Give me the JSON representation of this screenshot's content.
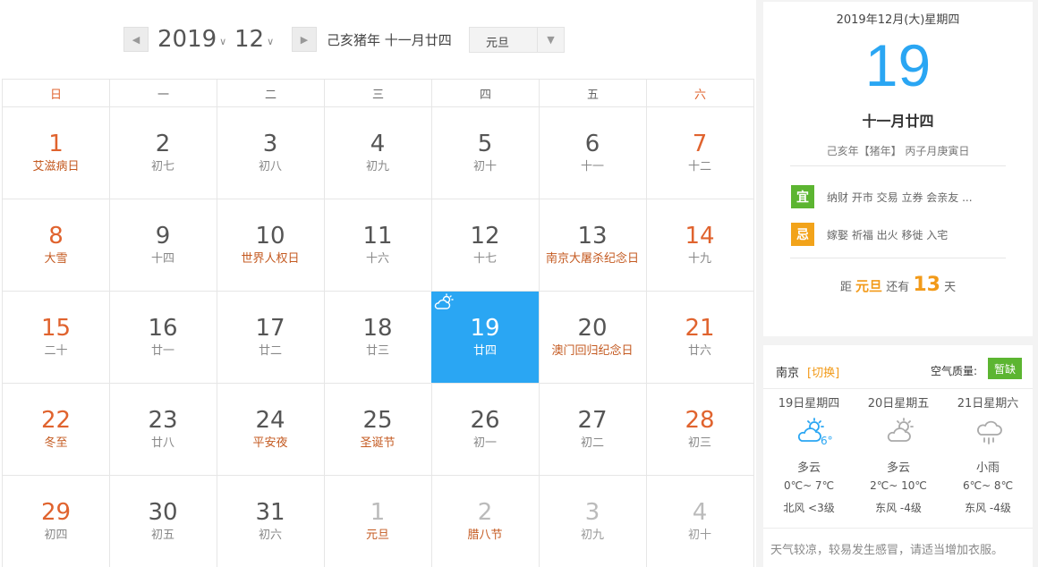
{
  "header": {
    "prev_symbol": "◀",
    "next_symbol": "▶",
    "year": "2019",
    "month": "12",
    "caret": "∨",
    "lunar_year": "己亥猪年 十一月廿四",
    "holiday_value": "元旦",
    "holiday_arrow": "▼"
  },
  "weekdays": [
    "日",
    "一",
    "二",
    "三",
    "四",
    "五",
    "六"
  ],
  "days": [
    {
      "d": "1",
      "sub": "艾滋病日",
      "fest": true,
      "other": false,
      "weekend": true
    },
    {
      "d": "2",
      "sub": "初七",
      "fest": false,
      "other": false,
      "weekend": false
    },
    {
      "d": "3",
      "sub": "初八",
      "fest": false,
      "other": false,
      "weekend": false
    },
    {
      "d": "4",
      "sub": "初九",
      "fest": false,
      "other": false,
      "weekend": false
    },
    {
      "d": "5",
      "sub": "初十",
      "fest": false,
      "other": false,
      "weekend": false
    },
    {
      "d": "6",
      "sub": "十一",
      "fest": false,
      "other": false,
      "weekend": false
    },
    {
      "d": "7",
      "sub": "十二",
      "fest": false,
      "other": false,
      "weekend": true
    },
    {
      "d": "8",
      "sub": "大雪",
      "fest": true,
      "other": false,
      "weekend": true
    },
    {
      "d": "9",
      "sub": "十四",
      "fest": false,
      "other": false,
      "weekend": false
    },
    {
      "d": "10",
      "sub": "世界人权日",
      "fest": true,
      "other": false,
      "weekend": false
    },
    {
      "d": "11",
      "sub": "十六",
      "fest": false,
      "other": false,
      "weekend": false
    },
    {
      "d": "12",
      "sub": "十七",
      "fest": false,
      "other": false,
      "weekend": false
    },
    {
      "d": "13",
      "sub": "南京大屠杀纪念日",
      "fest": true,
      "other": false,
      "weekend": false
    },
    {
      "d": "14",
      "sub": "十九",
      "fest": false,
      "other": false,
      "weekend": true
    },
    {
      "d": "15",
      "sub": "二十",
      "fest": false,
      "other": false,
      "weekend": true
    },
    {
      "d": "16",
      "sub": "廿一",
      "fest": false,
      "other": false,
      "weekend": false
    },
    {
      "d": "17",
      "sub": "廿二",
      "fest": false,
      "other": false,
      "weekend": false
    },
    {
      "d": "18",
      "sub": "廿三",
      "fest": false,
      "other": false,
      "weekend": false
    },
    {
      "d": "19",
      "sub": "廿四",
      "fest": false,
      "other": false,
      "weekend": false,
      "today": true
    },
    {
      "d": "20",
      "sub": "澳门回归纪念日",
      "fest": true,
      "other": false,
      "weekend": false
    },
    {
      "d": "21",
      "sub": "廿六",
      "fest": false,
      "other": false,
      "weekend": true
    },
    {
      "d": "22",
      "sub": "冬至",
      "fest": true,
      "other": false,
      "weekend": true
    },
    {
      "d": "23",
      "sub": "廿八",
      "fest": false,
      "other": false,
      "weekend": false
    },
    {
      "d": "24",
      "sub": "平安夜",
      "fest": true,
      "other": false,
      "weekend": false
    },
    {
      "d": "25",
      "sub": "圣诞节",
      "fest": true,
      "other": false,
      "weekend": false
    },
    {
      "d": "26",
      "sub": "初一",
      "fest": false,
      "other": false,
      "weekend": false
    },
    {
      "d": "27",
      "sub": "初二",
      "fest": false,
      "other": false,
      "weekend": false
    },
    {
      "d": "28",
      "sub": "初三",
      "fest": false,
      "other": false,
      "weekend": true
    },
    {
      "d": "29",
      "sub": "初四",
      "fest": false,
      "other": false,
      "weekend": true
    },
    {
      "d": "30",
      "sub": "初五",
      "fest": false,
      "other": false,
      "weekend": false
    },
    {
      "d": "31",
      "sub": "初六",
      "fest": false,
      "other": false,
      "weekend": false
    },
    {
      "d": "1",
      "sub": "元旦",
      "fest": true,
      "other": true,
      "weekend": false
    },
    {
      "d": "2",
      "sub": "腊八节",
      "fest": true,
      "other": true,
      "weekend": false
    },
    {
      "d": "3",
      "sub": "初九",
      "fest": false,
      "other": true,
      "weekend": false
    },
    {
      "d": "4",
      "sub": "初十",
      "fest": false,
      "other": true,
      "weekend": false
    }
  ],
  "detail": {
    "date": "2019年12月(大)星期四",
    "day": "19",
    "lunar": "十一月廿四",
    "ganzhi": "己亥年【猪年】 丙子月庚寅日",
    "yi_label": "宜",
    "yi_text": "纳财 开市 交易 立券 会亲友 ...",
    "ji_label": "忌",
    "ji_text": "嫁娶 祈福 出火 移徙 入宅",
    "countdown_pre": "距",
    "countdown_holiday": "元旦",
    "countdown_mid": "还有",
    "countdown_days": "13",
    "countdown_post": "天",
    "yi_color": "#5cb531",
    "ji_color": "#f2a31a"
  },
  "weather": {
    "city": "南京",
    "switch_label": "[切换]",
    "aq_label": "空气质量:",
    "aq_value": "暂缺",
    "forecast": [
      {
        "day": "19日星期四",
        "icon": "partly-cloudy-icon",
        "current": "6°",
        "desc": "多云",
        "temp": "0℃~ 7℃",
        "wind": "北风 <3级"
      },
      {
        "day": "20日星期五",
        "icon": "partly-cloudy-icon",
        "current": "",
        "desc": "多云",
        "temp": "2℃~ 10℃",
        "wind": "东风 -4级"
      },
      {
        "day": "21日星期六",
        "icon": "light-rain-icon",
        "current": "",
        "desc": "小雨",
        "temp": "6℃~ 8℃",
        "wind": "东风 -4级"
      }
    ],
    "tip": "天气较凉，较易发生感冒，请适当增加衣服。"
  }
}
